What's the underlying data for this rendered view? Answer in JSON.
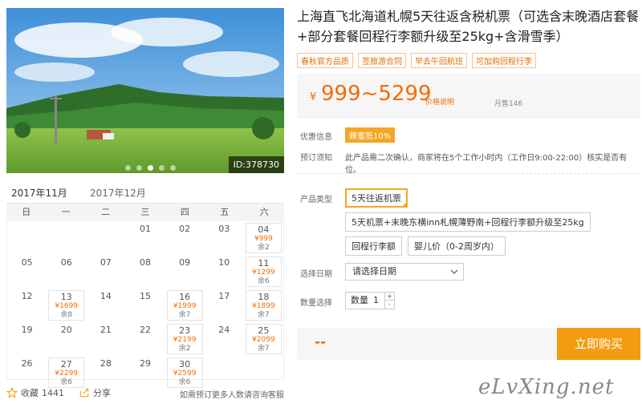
{
  "hero": {
    "id_label": "ID:378730",
    "slides": 5,
    "active_slide": 3
  },
  "calendar": {
    "tabs": [
      {
        "label": "2017年11月",
        "active": true
      },
      {
        "label": "2017年12月",
        "active": false
      }
    ],
    "weekdays": [
      "日",
      "一",
      "二",
      "三",
      "四",
      "五",
      "六"
    ],
    "cells": [
      {
        "d": "",
        "p": "",
        "r": ""
      },
      {
        "d": "",
        "p": "",
        "r": ""
      },
      {
        "d": "",
        "p": "",
        "r": ""
      },
      {
        "d": "01",
        "p": "",
        "r": ""
      },
      {
        "d": "02",
        "p": "",
        "r": ""
      },
      {
        "d": "03",
        "p": "",
        "r": ""
      },
      {
        "d": "04",
        "p": "¥999",
        "r": "余2"
      },
      {
        "d": "05",
        "p": "",
        "r": ""
      },
      {
        "d": "06",
        "p": "",
        "r": ""
      },
      {
        "d": "07",
        "p": "",
        "r": ""
      },
      {
        "d": "08",
        "p": "",
        "r": ""
      },
      {
        "d": "09",
        "p": "",
        "r": ""
      },
      {
        "d": "10",
        "p": "",
        "r": ""
      },
      {
        "d": "11",
        "p": "¥1299",
        "r": "余6"
      },
      {
        "d": "12",
        "p": "",
        "r": ""
      },
      {
        "d": "13",
        "p": "¥1699",
        "r": "余8"
      },
      {
        "d": "14",
        "p": "",
        "r": ""
      },
      {
        "d": "15",
        "p": "",
        "r": ""
      },
      {
        "d": "16",
        "p": "¥1999",
        "r": "余7"
      },
      {
        "d": "17",
        "p": "",
        "r": ""
      },
      {
        "d": "18",
        "p": "¥1899",
        "r": "余7"
      },
      {
        "d": "19",
        "p": "",
        "r": ""
      },
      {
        "d": "20",
        "p": "",
        "r": ""
      },
      {
        "d": "21",
        "p": "",
        "r": ""
      },
      {
        "d": "22",
        "p": "",
        "r": ""
      },
      {
        "d": "23",
        "p": "¥2199",
        "r": "余2"
      },
      {
        "d": "24",
        "p": "",
        "r": ""
      },
      {
        "d": "25",
        "p": "¥2099",
        "r": "余7"
      },
      {
        "d": "26",
        "p": "",
        "r": ""
      },
      {
        "d": "27",
        "p": "¥2299",
        "r": "余6"
      },
      {
        "d": "28",
        "p": "",
        "r": ""
      },
      {
        "d": "29",
        "p": "",
        "r": ""
      },
      {
        "d": "30",
        "p": "¥2599",
        "r": "余6"
      },
      {
        "d": "",
        "p": "",
        "r": ""
      },
      {
        "d": "",
        "p": "",
        "r": ""
      }
    ]
  },
  "footer": {
    "fav_label": "收藏",
    "fav_count": "1441",
    "share_label": "分享",
    "consult": "如需预订更多人数请咨询客服"
  },
  "product": {
    "title": "上海直飞北海道札幌5天往返含税机票（可选含末晚酒店套餐+部分套餐回程行李额升级至25kg+含滑雪季）",
    "tags": [
      "春秋官方品质",
      "签旅游合同",
      "早去午回航班",
      "可加购回程行李"
    ],
    "currency": "¥",
    "price_range": "999~5299",
    "price_note": "价格说明",
    "monthly_sales": "月售146",
    "discount_label": "优惠信息",
    "discount_badge": "蜂蜜抵10%",
    "notice_label": "预订须知",
    "notice": "此产品需二次确认，商家将在5个工作小时内（工作日9:00-22:00）核实是否有位。",
    "type_label": "产品类型",
    "options": [
      "5天往返机票",
      "5天机票+末晚东横inn札幌薄野南+回程行李额升级至25kg",
      "回程行李额",
      "婴儿价（0-2周岁内）"
    ],
    "selected_option": 0,
    "date_label": "选择日期",
    "date_placeholder": "请选择日期",
    "qty_label": "数量选择",
    "qty_prefix": "数量",
    "qty_value": "1",
    "total": "--",
    "buy_label": "立即购买"
  },
  "watermark": "eLvXing.net",
  "colors": {
    "accent": "#f5a623",
    "price": "#f36b00",
    "buy": "#f39c12"
  }
}
